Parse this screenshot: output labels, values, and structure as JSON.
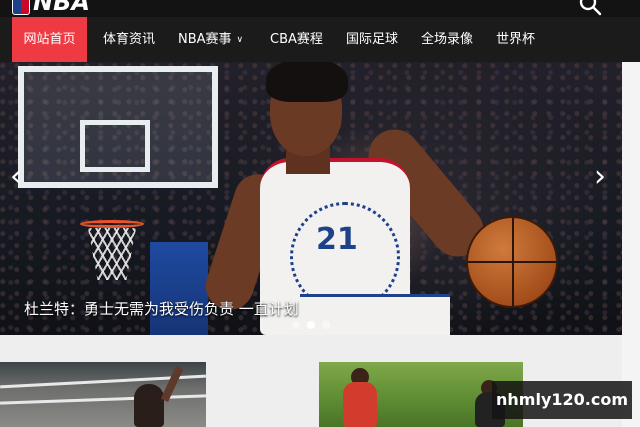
{
  "header": {
    "logo_text": "NBA",
    "search_icon": "search-icon"
  },
  "nav": {
    "items": [
      {
        "label": "网站首页",
        "active": true
      },
      {
        "label": "体育资讯"
      },
      {
        "label": "NBA赛事",
        "has_dropdown": true
      },
      {
        "label": "CBA赛程"
      },
      {
        "label": "国际足球"
      },
      {
        "label": "全场录像"
      },
      {
        "label": "世界杯"
      }
    ],
    "dropdown_icon": "chevron-down-icon",
    "active_color": "#ee3a43"
  },
  "banner": {
    "caption": "杜兰特：勇士无需为我受伤负责 一直计划",
    "jersey_number": "21",
    "prev_icon": "chevron-left-icon",
    "next_icon": "chevron-right-icon",
    "prev_glyph": "‹",
    "next_glyph": "›",
    "slides_count": 3,
    "active_slide": 2
  },
  "watermark": {
    "text": "nhmly120.com"
  }
}
